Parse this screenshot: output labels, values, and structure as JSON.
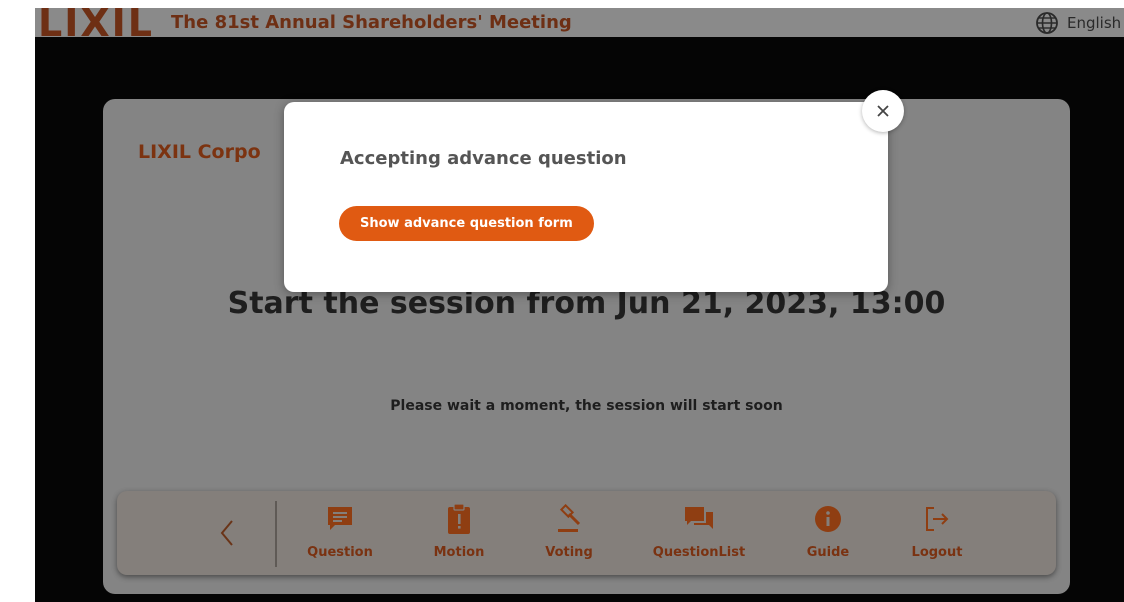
{
  "header": {
    "logo_text": "LIXIL",
    "meeting_title": "The 81st Annual Shareholders' Meeting",
    "language_label": "English",
    "language_icon": "globe-icon"
  },
  "card": {
    "company": "LIXIL Corpo",
    "session_title": "Start the session from Jun 21, 2023, 13:00",
    "session_subtitle": "Please wait a moment, the session will start soon"
  },
  "nav": {
    "back_icon": "chevron-left-icon",
    "items": [
      {
        "label": "Question",
        "icon": "speech-bubble-icon"
      },
      {
        "label": "Motion",
        "icon": "clipboard-alert-icon"
      },
      {
        "label": "Voting",
        "icon": "gavel-icon"
      },
      {
        "label": "QuestionList",
        "icon": "chat-bubbles-icon"
      },
      {
        "label": "Guide",
        "icon": "info-icon"
      },
      {
        "label": "Logout",
        "icon": "logout-icon"
      }
    ]
  },
  "modal": {
    "title": "Accepting advance question",
    "button_label": "Show advance question form",
    "close_icon": "close-icon"
  },
  "colors": {
    "accent": "#e05a12",
    "brand_dim": "#7a3211",
    "overlay_card": "#848484",
    "background": "#050505"
  }
}
